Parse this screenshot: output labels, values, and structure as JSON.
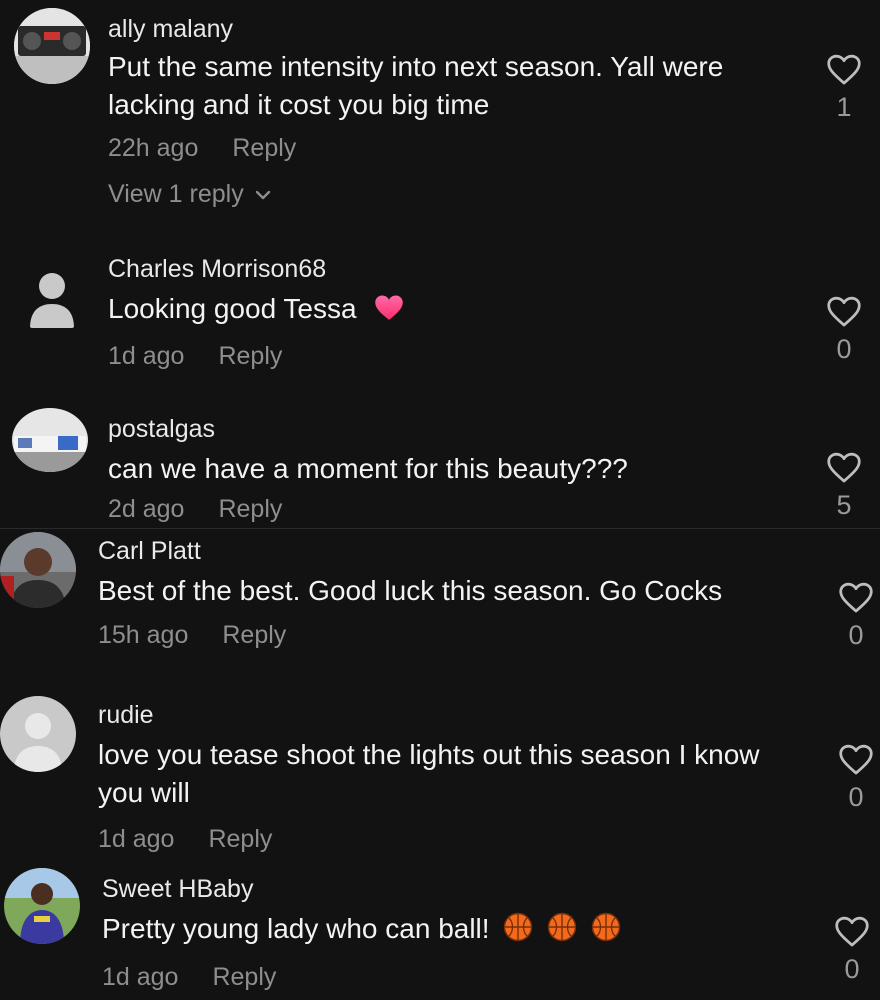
{
  "comments": [
    {
      "username": "ally malany",
      "text": "Put the same intensity into next season. Yall were lacking and it cost you big time",
      "time": "22h ago",
      "reply_label": "Reply",
      "likes": "1",
      "view_replies": "View 1 reply",
      "avatar": "photo-boombox"
    },
    {
      "username": "Charles Morrison68",
      "text": "Looking good Tessa",
      "time": "1d ago",
      "reply_label": "Reply",
      "likes": "0",
      "avatar": "default-person-icon",
      "emoji": "pink-heart-icon"
    },
    {
      "username": "postalgas",
      "text": "can we have a moment for this beauty???",
      "time": "2d ago",
      "reply_label": "Reply",
      "likes": "5",
      "avatar": "photo-truck"
    },
    {
      "username": "Carl Platt",
      "text": "Best of the best. Good luck this season. Go Cocks",
      "time": "15h ago",
      "reply_label": "Reply",
      "likes": "0",
      "avatar": "photo-man"
    },
    {
      "username": "rudie",
      "text": "love you tease shoot the lights out this season I know you will",
      "time": "1d ago",
      "reply_label": "Reply",
      "likes": "0",
      "avatar": "default-gray-avatar"
    },
    {
      "username": "Sweet HBaby",
      "text": "Pretty young lady who can ball!",
      "time": "1d ago",
      "reply_label": "Reply",
      "likes": "0",
      "avatar": "photo-person-outdoors",
      "emoji": "basketball-icon"
    }
  ],
  "colors": {
    "background": "#121212",
    "text": "#f1f1f1",
    "muted": "#8e8e8e",
    "heart_emoji": "#ff3b7f",
    "basketball": "#f26b1d"
  }
}
